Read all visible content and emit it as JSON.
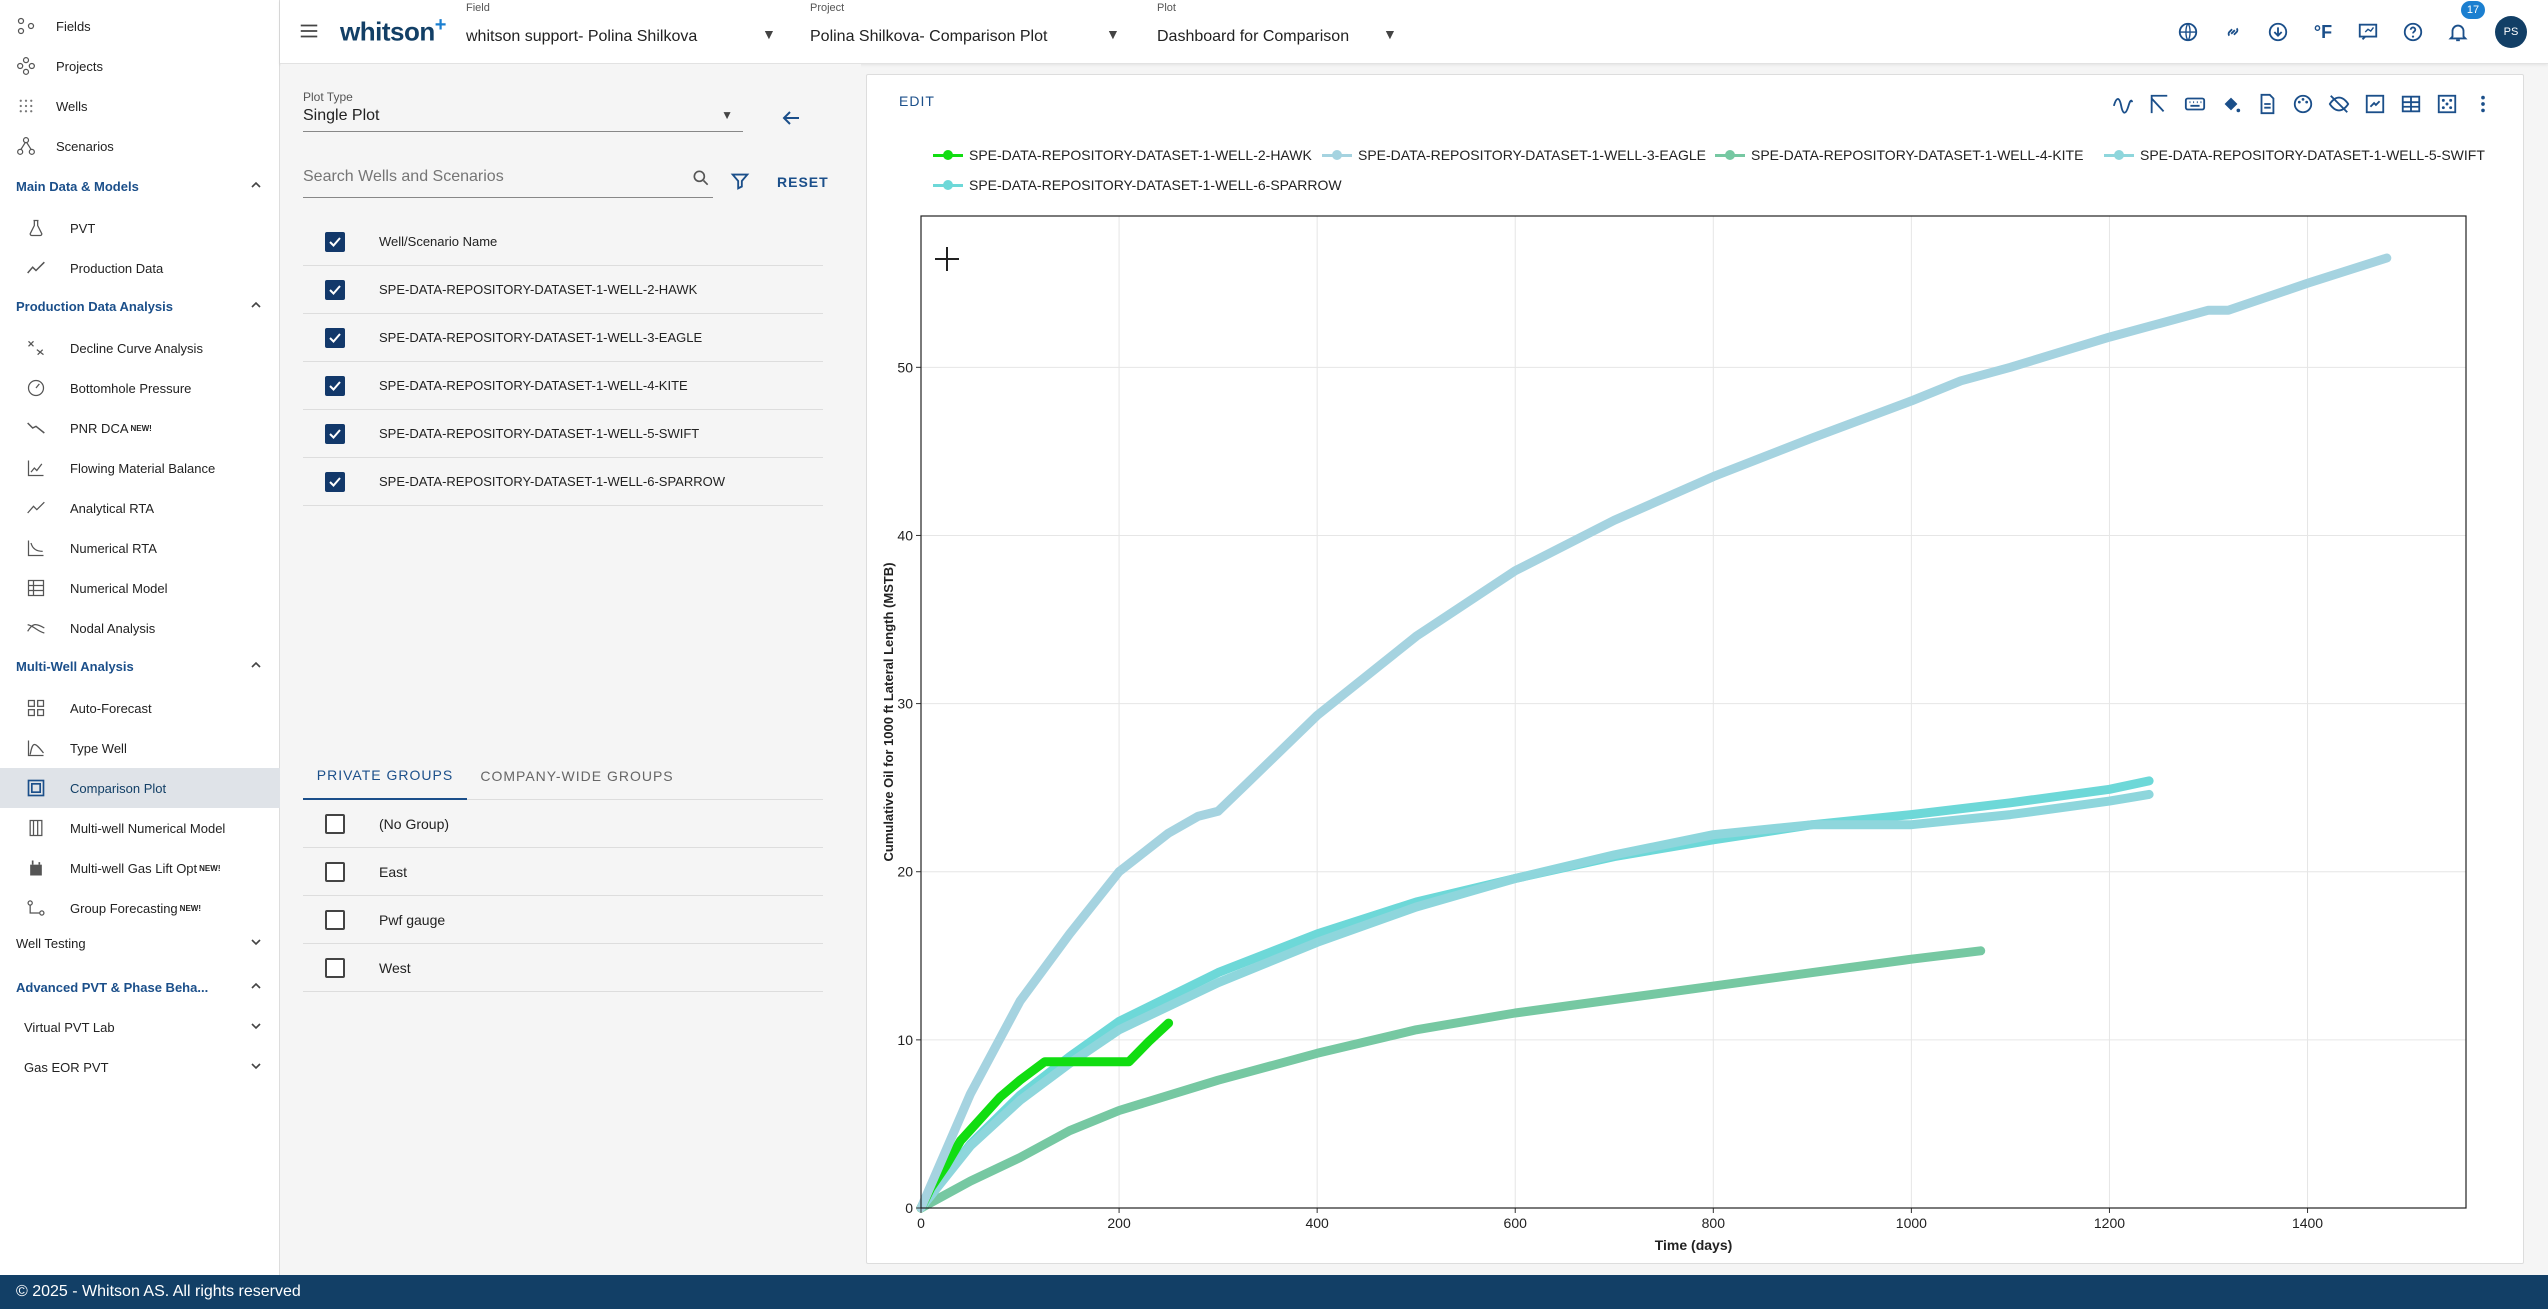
{
  "sidebar": {
    "top_items": [
      {
        "label": "Fields",
        "icon": "fields-icon"
      },
      {
        "label": "Projects",
        "icon": "projects-icon"
      },
      {
        "label": "Wells",
        "icon": "wells-icon"
      },
      {
        "label": "Scenarios",
        "icon": "scenarios-icon"
      }
    ],
    "sections": [
      {
        "label": "Main Data & Models",
        "expanded": true,
        "items": [
          {
            "label": "PVT",
            "icon": "flask-icon"
          },
          {
            "label": "Production Data",
            "icon": "trend-icon"
          }
        ]
      },
      {
        "label": "Production Data Analysis",
        "expanded": true,
        "items": [
          {
            "label": "Decline Curve Analysis",
            "icon": "decline-icon"
          },
          {
            "label": "Bottomhole Pressure",
            "icon": "gauge-icon"
          },
          {
            "label": "PNR DCA",
            "new": "NEW!",
            "icon": "pnr-icon"
          },
          {
            "label": "Flowing Material Balance",
            "icon": "fmb-icon"
          },
          {
            "label": "Analytical RTA",
            "icon": "rta-icon"
          },
          {
            "label": "Numerical RTA",
            "icon": "numrta-icon"
          },
          {
            "label": "Numerical Model",
            "icon": "grid-icon"
          },
          {
            "label": "Nodal Analysis",
            "icon": "nodal-icon"
          }
        ]
      },
      {
        "label": "Multi-Well Analysis",
        "expanded": true,
        "items": [
          {
            "label": "Auto-Forecast",
            "icon": "autoforecast-icon"
          },
          {
            "label": "Type Well",
            "icon": "typewell-icon"
          },
          {
            "label": "Comparison Plot",
            "icon": "comparison-icon",
            "active": true
          },
          {
            "label": "Multi-well Numerical Model",
            "icon": "mwnm-icon"
          },
          {
            "label": "Multi-well Gas Lift Opt",
            "new": "NEW!",
            "icon": "gaslift-icon"
          },
          {
            "label": "Group Forecasting",
            "new": "NEW!",
            "icon": "group-icon"
          }
        ]
      }
    ],
    "collapsed_sections": {
      "well_testing": "Well Testing",
      "advanced_pvt": "Advanced PVT & Phase Beha...",
      "virtual_pvt_lab": "Virtual PVT Lab",
      "gas_eor_pvt": "Gas EOR PVT"
    }
  },
  "topbar": {
    "logo": "whitson",
    "logo_plus": "+",
    "field_label": "Field",
    "field_value": "whitson support- Polina Shilkova",
    "project_label": "Project",
    "project_value": "Polina Shilkova- Comparison Plot",
    "plot_label": "Plot",
    "plot_value": "Dashboard for Comparison",
    "temp_unit": "°F",
    "notification_count": "17",
    "avatar": "PS"
  },
  "left_panel": {
    "plot_type_label": "Plot Type",
    "plot_type_value": "Single Plot",
    "search_placeholder": "Search Wells and Scenarios",
    "reset_label": "RESET",
    "table_header": "Well/Scenario Name",
    "wells": [
      "SPE-DATA-REPOSITORY-DATASET-1-WELL-2-HAWK",
      "SPE-DATA-REPOSITORY-DATASET-1-WELL-3-EAGLE",
      "SPE-DATA-REPOSITORY-DATASET-1-WELL-4-KITE",
      "SPE-DATA-REPOSITORY-DATASET-1-WELL-5-SWIFT",
      "SPE-DATA-REPOSITORY-DATASET-1-WELL-6-SPARROW"
    ],
    "tabs": [
      "PRIVATE GROUPS",
      "COMPANY-WIDE GROUPS"
    ],
    "groups": [
      "(No Group)",
      "East",
      "Pwf gauge",
      "West"
    ]
  },
  "chart_card": {
    "edit_label": "EDIT"
  },
  "chart_data": {
    "type": "line",
    "xlabel": "Time (days)",
    "ylabel": "Cumulative Oil for 1000 ft Lateral Length (MSTB)",
    "xlim": [
      0,
      1560
    ],
    "ylim": [
      0,
      59
    ],
    "xticks": [
      0,
      200,
      400,
      600,
      800,
      1000,
      1200,
      1400
    ],
    "yticks": [
      0,
      10,
      20,
      30,
      40,
      50
    ],
    "grid": true,
    "legend_position": "top",
    "series": [
      {
        "name": "SPE-DATA-REPOSITORY-DATASET-1-WELL-2-HAWK",
        "color": "#11dd11",
        "x": [
          0,
          10,
          25,
          40,
          60,
          80,
          100,
          125,
          150,
          175,
          210,
          230,
          250
        ],
        "y": [
          0,
          1.2,
          2.5,
          4.0,
          5.3,
          6.6,
          7.6,
          8.7,
          8.7,
          8.7,
          8.7,
          9.9,
          11.0
        ]
      },
      {
        "name": "SPE-DATA-REPOSITORY-DATASET-1-WELL-3-EAGLE",
        "color": "#a5d3e0",
        "x": [
          0,
          50,
          100,
          150,
          200,
          250,
          280,
          300,
          330,
          400,
          500,
          600,
          700,
          800,
          900,
          1000,
          1050,
          1100,
          1200,
          1300,
          1320,
          1400,
          1480
        ],
        "y": [
          0,
          6.8,
          12.3,
          16.3,
          20.0,
          22.3,
          23.3,
          23.6,
          25.3,
          29.3,
          34.0,
          37.9,
          40.9,
          43.5,
          45.8,
          48.0,
          49.2,
          50.0,
          51.8,
          53.4,
          53.4,
          55.0,
          56.5
        ]
      },
      {
        "name": "SPE-DATA-REPOSITORY-DATASET-1-WELL-4-KITE",
        "color": "#76c8a2",
        "x": [
          0,
          50,
          100,
          150,
          200,
          300,
          400,
          500,
          600,
          700,
          800,
          850,
          900,
          1000,
          1070
        ],
        "y": [
          0,
          1.6,
          3.0,
          4.6,
          5.8,
          7.6,
          9.2,
          10.6,
          11.6,
          12.4,
          13.2,
          13.6,
          14.0,
          14.8,
          15.3
        ]
      },
      {
        "name": "SPE-DATA-REPOSITORY-DATASET-1-WELL-5-SWIFT",
        "color": "#8ed6dc",
        "x": [
          0,
          50,
          100,
          150,
          200,
          300,
          400,
          500,
          600,
          700,
          800,
          900,
          950,
          1000,
          1100,
          1200,
          1240
        ],
        "y": [
          0,
          3.7,
          6.4,
          8.6,
          10.6,
          13.4,
          15.8,
          17.9,
          19.6,
          21.0,
          22.2,
          22.8,
          22.8,
          22.8,
          23.4,
          24.2,
          24.6
        ]
      },
      {
        "name": "SPE-DATA-REPOSITORY-DATASET-1-WELL-6-SPARROW",
        "color": "#6dd8d8",
        "x": [
          0,
          50,
          100,
          150,
          200,
          300,
          400,
          500,
          600,
          700,
          800,
          900,
          1000,
          1100,
          1200,
          1240
        ],
        "y": [
          0,
          3.8,
          6.7,
          9.0,
          11.1,
          14.0,
          16.3,
          18.2,
          19.6,
          20.9,
          21.9,
          22.8,
          23.4,
          24.1,
          24.9,
          25.4
        ]
      }
    ]
  }
}
